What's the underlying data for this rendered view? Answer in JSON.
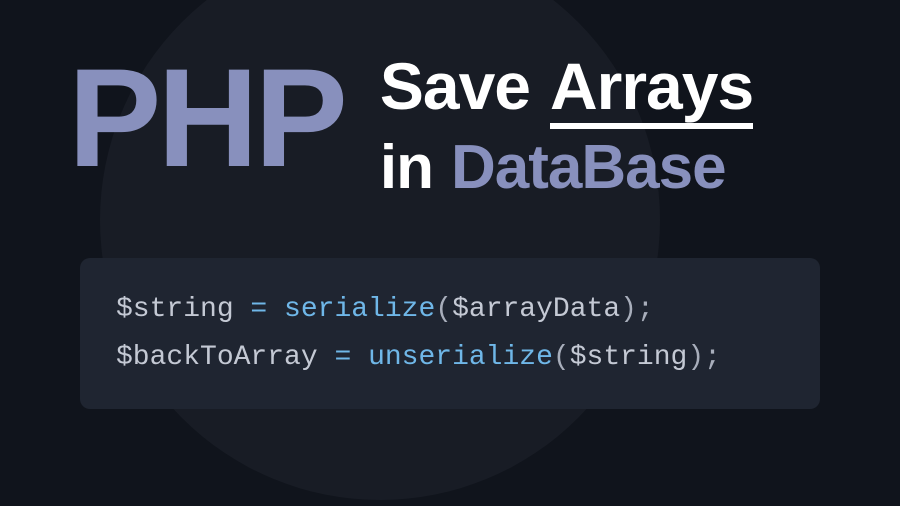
{
  "hero": {
    "php_label": "PHP",
    "line1_word1": "Save",
    "line1_word2": "Arrays",
    "line2_word1": "in",
    "line2_word2": "DataBase"
  },
  "code": {
    "l1_var1": "$string",
    "l1_eq": " = ",
    "l1_fn": "serialize",
    "l1_open": "(",
    "l1_arg": "$arrayData",
    "l1_close": ")",
    "l1_semi": ";",
    "l2_var1": "$backToArray",
    "l2_eq": " = ",
    "l2_fn": "unserialize",
    "l2_open": "(",
    "l2_arg": "$string",
    "l2_close": ")",
    "l2_semi": ";"
  }
}
